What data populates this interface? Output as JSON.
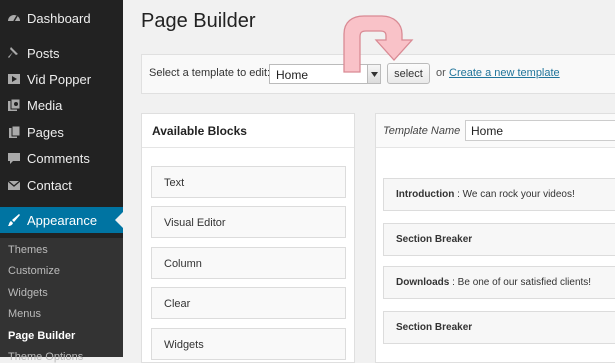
{
  "sidebar": {
    "items": [
      {
        "label": "Dashboard",
        "icon": "dashboard-icon"
      },
      {
        "label": "Posts",
        "icon": "pin-icon"
      },
      {
        "label": "Vid Popper",
        "icon": "video-icon"
      },
      {
        "label": "Media",
        "icon": "media-icon"
      },
      {
        "label": "Pages",
        "icon": "pages-icon"
      },
      {
        "label": "Comments",
        "icon": "comment-icon"
      },
      {
        "label": "Contact",
        "icon": "mail-icon"
      }
    ],
    "active": {
      "label": "Appearance",
      "icon": "brush-icon"
    },
    "submenu": [
      "Themes",
      "Customize",
      "Widgets",
      "Menus",
      "Page Builder",
      "Theme Options"
    ]
  },
  "page": {
    "title": "Page Builder"
  },
  "template_bar": {
    "label": "Select a template to edit:",
    "selected": "Home",
    "button": "select",
    "or_text": "or",
    "link": "Create a new template"
  },
  "blocks_panel": {
    "title": "Available Blocks",
    "blocks": [
      "Text",
      "Visual Editor",
      "Column",
      "Clear",
      "Widgets"
    ]
  },
  "template_panel": {
    "name_label": "Template Name",
    "name_value": "Home",
    "sections": [
      {
        "bold": "Introduction",
        "rest": " : We can rock your videos!"
      },
      {
        "bold": "Section Breaker",
        "rest": ""
      },
      {
        "bold": "Downloads",
        "rest": " : Be one of our satisfied clients!"
      },
      {
        "bold": "Section Breaker",
        "rest": ""
      }
    ]
  },
  "colors": {
    "sidebar_bg": "#222222",
    "active_bg": "#0074a2",
    "link": "#21759b",
    "arrow_fill": "#f9c2c8",
    "arrow_stroke": "#d98a94"
  }
}
